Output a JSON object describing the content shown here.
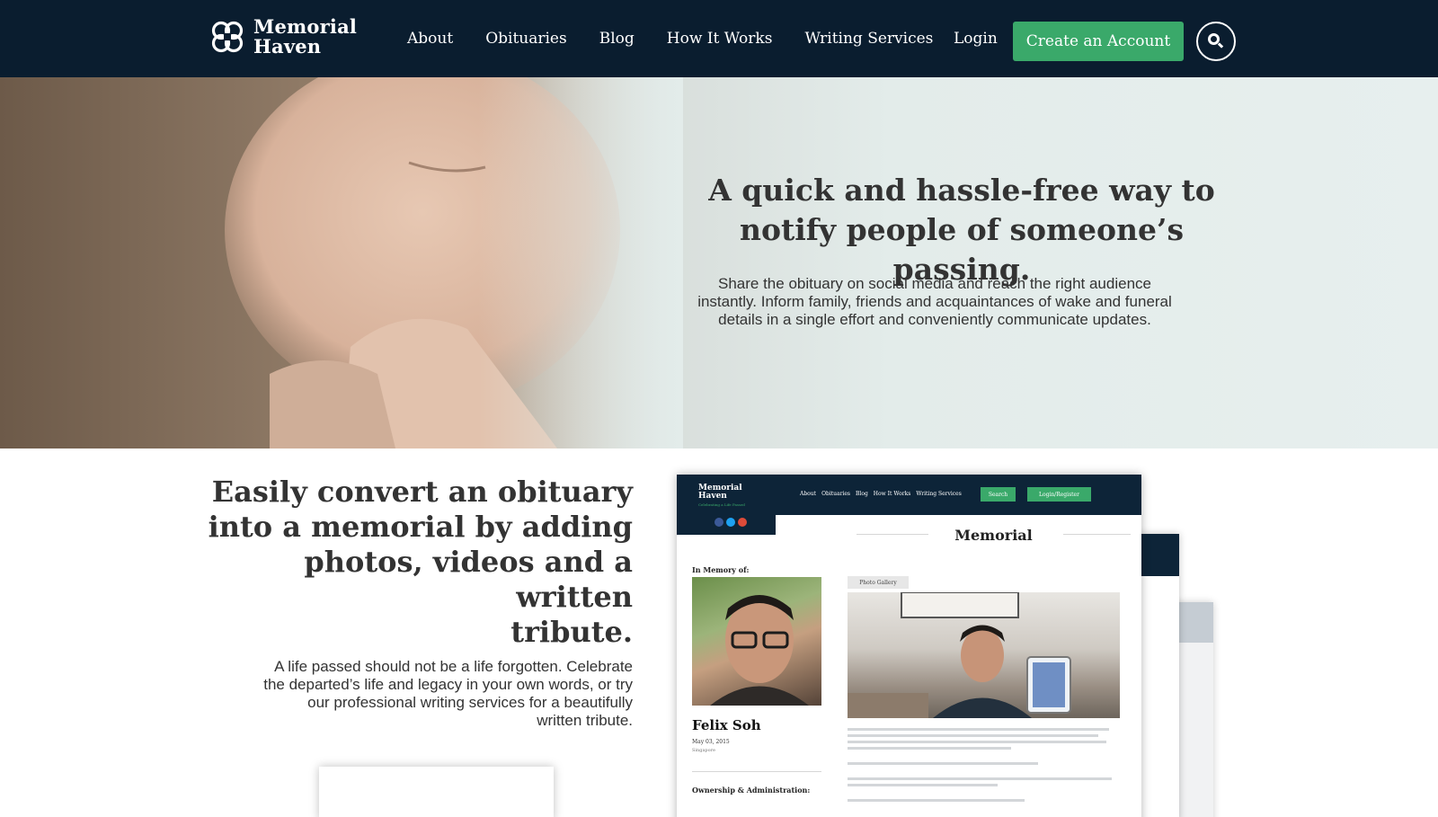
{
  "header": {
    "logo_line1": "Memorial",
    "logo_line2": "Haven",
    "nav": [
      "About",
      "Obituaries",
      "Blog",
      "How It Works",
      "Writing Services"
    ],
    "login": "Login",
    "create_account": "Create an Account",
    "search_icon": "search-icon"
  },
  "hero": {
    "title_line1": "A quick and hassle-free way to",
    "title_line2": "notify people of someone’s passing.",
    "text_line1": "Share the obituary on social media and reach the right audience",
    "text_line2": "instantly. Inform family, friends and acquaintances of wake and funeral",
    "text_line3": "details in a single effort and conveniently communicate updates."
  },
  "section": {
    "title_line1": "Easily convert an obituary",
    "title_line2": "into a memorial by adding",
    "title_line3": "photos, videos and a written",
    "title_line4": "tribute.",
    "text_line1": "A life passed should not be a life forgotten. Celebrate",
    "text_line2": "the departed’s life and legacy in your own words, or try",
    "text_line3": "our professional writing services for a beautifully",
    "text_line4": "written tribute."
  },
  "mockup": {
    "logo_line1": "Memorial",
    "logo_line2": "Haven",
    "tagline": "Celebrating a Life Passed",
    "nav": [
      "About",
      "Obituaries",
      "Blog",
      "How It Works",
      "Writing Services"
    ],
    "search": "Search",
    "login_register": "Login/Register",
    "heading": "Memorial",
    "in_memory": "In Memory of:",
    "name": "Felix Soh",
    "date": "May 03, 2015",
    "place": "Singapore",
    "gallery_tab": "Photo Gallery",
    "ownership": "Ownership & Administration:",
    "social_colors": [
      "#3b5998",
      "#1da1f2",
      "#dd4b39"
    ]
  },
  "colors": {
    "header_bg": "#0a1d2f",
    "accent_green": "#3aa96a"
  }
}
